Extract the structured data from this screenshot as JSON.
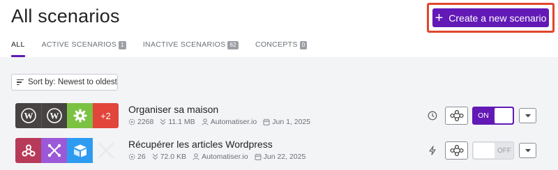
{
  "page": {
    "title": "All scenarios"
  },
  "create_button": {
    "label": "Create a new scenario"
  },
  "tabs": [
    {
      "label": "ALL",
      "count": ""
    },
    {
      "label": "ACTIVE SCENARIOS",
      "count": "1"
    },
    {
      "label": "INACTIVE SCENARIOS",
      "count": "62"
    },
    {
      "label": "CONCEPTS",
      "count": "0"
    }
  ],
  "sort": {
    "label": "Sort by: Newest to oldest"
  },
  "colors": {
    "accent": "#6219b6",
    "highlight": "#e0462d"
  },
  "scenarios": [
    {
      "name": "Organiser sa maison",
      "operations": "2268",
      "data": "11.1 MB",
      "owner": "Automatiser.io",
      "date": "Jun 1, 2025",
      "apps": [
        "wordpress-icon",
        "wordpress-icon",
        "tools-gear-icon"
      ],
      "more_apps": "+2",
      "schedule_icon": "clock-icon",
      "toggle": "ON"
    },
    {
      "name": "Récupérer les articles Wordpress",
      "operations": "26",
      "data": "72.0 KB",
      "owner": "Automatiser.io",
      "date": "Jun 22, 2025",
      "apps": [
        "webhooks-icon",
        "flow-control-icon",
        "airtable-icon"
      ],
      "schedule_icon": "lightning-icon",
      "toggle": "OFF"
    }
  ]
}
